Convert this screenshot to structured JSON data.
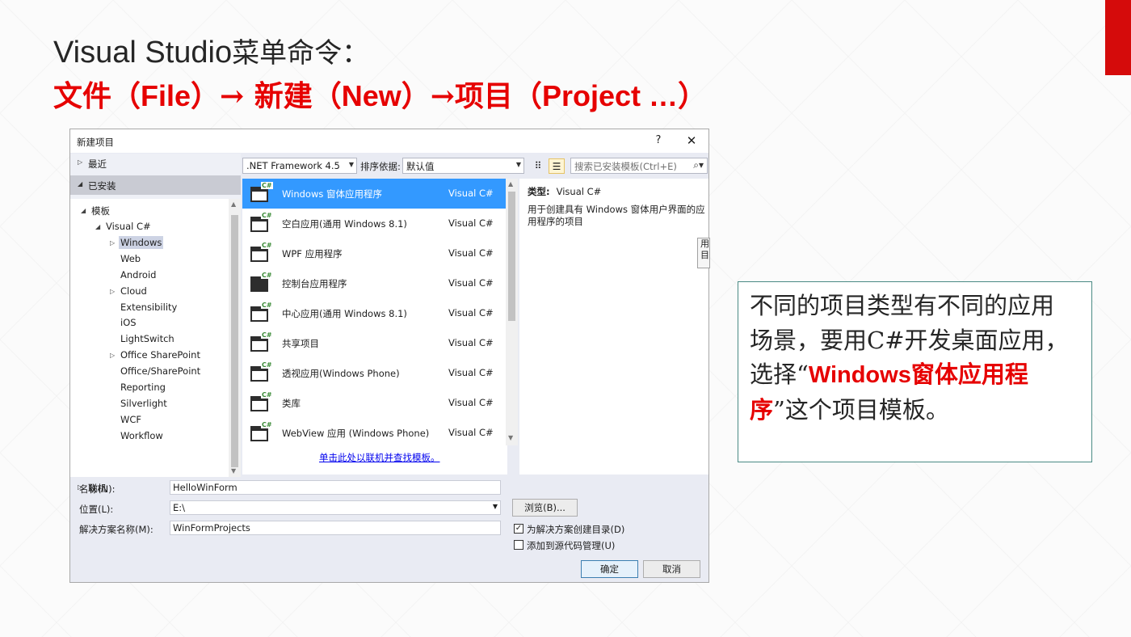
{
  "slide": {
    "title_line1_en": "Visual Studio",
    "title_line1_zh": "菜单命令：",
    "title_line2_a": "文件（",
    "title_line2_b": "File",
    "title_line2_c": "）→ 新建（",
    "title_line2_d": "New",
    "title_line2_e": "）→项目（",
    "title_line2_f": "Project …",
    "title_line2_g": "）",
    "accent_color": "#e60000"
  },
  "dialog": {
    "title": "新建项目",
    "help": "?",
    "close": "✕",
    "left": {
      "recent": "最近",
      "installed": "已安装",
      "online": "联机",
      "tree": {
        "templates": "模板",
        "visual_csharp": "Visual C#",
        "items": [
          "Windows",
          "Web",
          "Android",
          "Cloud",
          "Extensibility",
          "iOS",
          "LightSwitch",
          "Office SharePoint",
          "Office/SharePoint",
          "Reporting",
          "Silverlight",
          "WCF",
          "Workflow"
        ],
        "selected": "Windows"
      }
    },
    "toolbar": {
      "framework": ".NET Framework 4.5",
      "sort_label": "排序依据:",
      "sort_value": "默认值",
      "search_placeholder": "搜索已安装模板(Ctrl+E)"
    },
    "templates": [
      {
        "name": "Windows 窗体应用程序",
        "lang": "Visual C#",
        "selected": true
      },
      {
        "name": "空白应用(通用 Windows 8.1)",
        "lang": "Visual C#"
      },
      {
        "name": "WPF 应用程序",
        "lang": "Visual C#"
      },
      {
        "name": "控制台应用程序",
        "lang": "Visual C#"
      },
      {
        "name": "中心应用(通用 Windows 8.1)",
        "lang": "Visual C#"
      },
      {
        "name": "共享项目",
        "lang": "Visual C#"
      },
      {
        "name": "透视应用(Windows Phone)",
        "lang": "Visual C#"
      },
      {
        "name": "类库",
        "lang": "Visual C#"
      },
      {
        "name": "WebView 应用 (Windows Phone)",
        "lang": "Visual C#"
      }
    ],
    "online_link": "单击此处以联机并查找模板。",
    "detail": {
      "type_label": "类型:",
      "type_value": "Visual C#",
      "description": "用于创建具有 Windows 窗体用户界面的应用程序的项目",
      "tooltip_fragment": "用 目"
    },
    "form": {
      "name_label": "名称(N):",
      "name_value": "HelloWinForm",
      "location_label": "位置(L):",
      "location_value": "E:\\",
      "browse": "浏览(B)...",
      "solution_label": "解决方案名称(M):",
      "solution_value": "WinFormProjects",
      "create_dir": "为解决方案创建目录(D)",
      "create_dir_checked": true,
      "add_scc": "添加到源代码管理(U)",
      "add_scc_checked": false,
      "ok": "确定",
      "cancel": "取消"
    }
  },
  "callout": {
    "text_a": "不同的项目类型有不同的应用场景，要用C#开发桌面应用，选择“",
    "highlight_en": "Windows",
    "highlight_zh": "窗体应用程序",
    "text_b": "”这个项目模板。"
  }
}
